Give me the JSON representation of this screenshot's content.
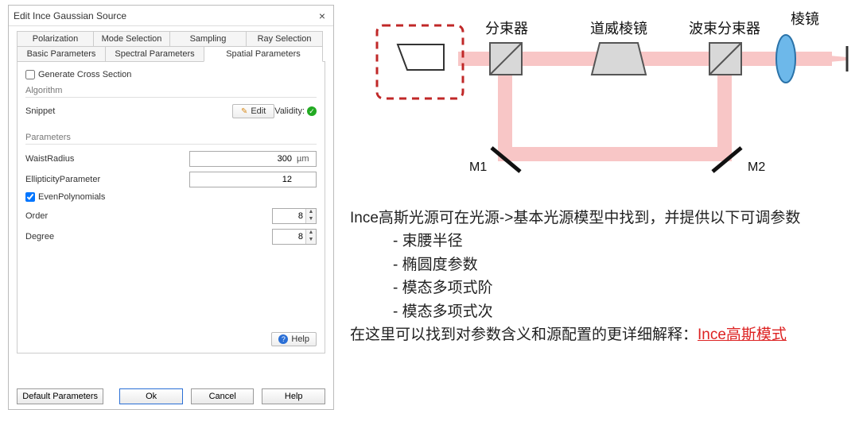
{
  "dialog": {
    "title": "Edit Ince Gaussian Source",
    "tabs_row1": [
      "Polarization",
      "Mode Selection",
      "Sampling",
      "Ray Selection"
    ],
    "tabs_row2": [
      "Basic Parameters",
      "Spectral Parameters",
      "Spatial Parameters"
    ],
    "active_tab": "Spatial Parameters",
    "generate_cross_section": {
      "label": "Generate Cross Section",
      "checked": false
    },
    "algorithm": {
      "group": "Algorithm",
      "snippet_label": "Snippet",
      "edit_btn": "Edit",
      "validity_label": "Validity:",
      "validity_ok": true
    },
    "parameters": {
      "group": "Parameters",
      "waist": {
        "label": "WaistRadius",
        "value": "300",
        "unit": "µm"
      },
      "ellipticity": {
        "label": "EllipticityParameter",
        "value": "12",
        "unit": ""
      },
      "even_poly": {
        "label": "EvenPolynomials",
        "checked": true
      },
      "order": {
        "label": "Order",
        "value": "8"
      },
      "degree": {
        "label": "Degree",
        "value": "8"
      }
    },
    "help": "Help",
    "buttons": {
      "default": "Default Parameters",
      "ok": "Ok",
      "cancel": "Cancel",
      "help": "Help"
    }
  },
  "diagram": {
    "labels": {
      "splitter": "分束器",
      "dove": "道威棱镜",
      "beam_splitter": "波束分束器",
      "prism": "棱镜",
      "m1": "M1",
      "m2": "M2"
    }
  },
  "description": {
    "line1": "Ince高斯光源可在光源->基本光源模型中找到，并提供以下可调参数",
    "b1": "- 束腰半径",
    "b2": "- 椭圆度参数",
    "b3": "- 模态多项式阶",
    "b4": "- 模态多项式次",
    "line2_a": "在这里可以找到对参数含义和源配置的更详细解释：",
    "line2_link": "Ince高斯模式"
  }
}
